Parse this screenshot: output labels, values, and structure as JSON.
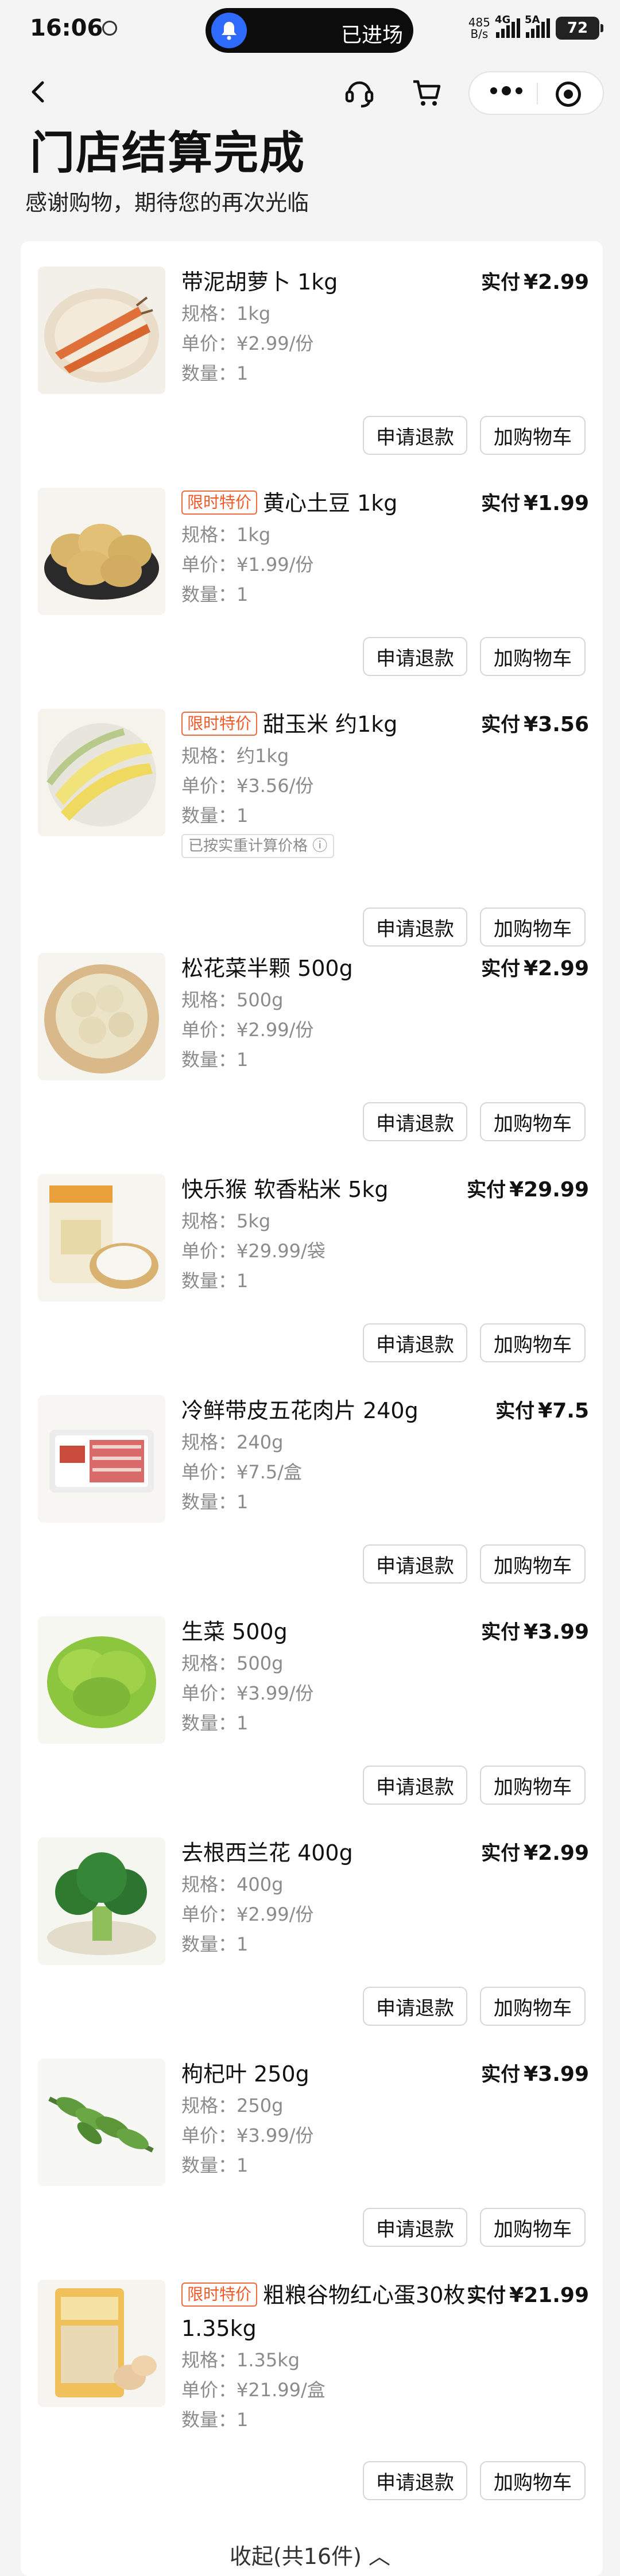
{
  "status": {
    "time": "16:06",
    "island_text": "已进场",
    "net_speed": "485",
    "net_unit": "B/s",
    "net_type": "4G",
    "net_type2": "5A",
    "battery": "72"
  },
  "header": {
    "title": "门店结算完成",
    "subtitle": "感谢购物，期待您的再次光临"
  },
  "labels": {
    "paid": "实付",
    "spec": "规格：",
    "unit_price": "单价：",
    "qty": "数量：",
    "refund": "申请退款",
    "add_cart": "加购物车"
  },
  "items": [
    {
      "name": "带泥胡萝卜 1kg",
      "tag": "",
      "price": "¥2.99",
      "spec": "1kg",
      "unit_price": "¥2.99/份",
      "qty": "1",
      "note": "",
      "thumb": "carrot"
    },
    {
      "name": "黄心土豆 1kg",
      "tag": "限时特价",
      "price": "¥1.99",
      "spec": "1kg",
      "unit_price": "¥1.99/份",
      "qty": "1",
      "note": "",
      "thumb": "potato"
    },
    {
      "name": "甜玉米 约1kg",
      "tag": "限时特价",
      "price": "¥3.56",
      "spec": "约1kg",
      "unit_price": "¥3.56/份",
      "qty": "1",
      "note": "已按实重计算价格",
      "thumb": "corn"
    },
    {
      "name": "松花菜半颗 500g",
      "tag": "",
      "price": "¥2.99",
      "spec": "500g",
      "unit_price": "¥2.99/份",
      "qty": "1",
      "note": "",
      "thumb": "cauliflower"
    },
    {
      "name": "快乐猴 软香粘米 5kg",
      "tag": "",
      "price": "¥29.99",
      "spec": "5kg",
      "unit_price": "¥29.99/袋",
      "qty": "1",
      "note": "",
      "thumb": "rice"
    },
    {
      "name": "冷鲜带皮五花肉片 240g",
      "tag": "",
      "price": "¥7.5",
      "spec": "240g",
      "unit_price": "¥7.5/盒",
      "qty": "1",
      "note": "",
      "thumb": "pork"
    },
    {
      "name": "生菜 500g",
      "tag": "",
      "price": "¥3.99",
      "spec": "500g",
      "unit_price": "¥3.99/份",
      "qty": "1",
      "note": "",
      "thumb": "lettuce"
    },
    {
      "name": "去根西兰花 400g",
      "tag": "",
      "price": "¥2.99",
      "spec": "400g",
      "unit_price": "¥2.99/份",
      "qty": "1",
      "note": "",
      "thumb": "broccoli"
    },
    {
      "name": "枸杞叶 250g",
      "tag": "",
      "price": "¥3.99",
      "spec": "250g",
      "unit_price": "¥3.99/份",
      "qty": "1",
      "note": "",
      "thumb": "greens"
    },
    {
      "name": "粗粮谷物红心蛋30枚 1.35kg",
      "tag": "限时特价",
      "price": "¥21.99",
      "spec": "1.35kg",
      "unit_price": "¥21.99/盒",
      "qty": "1",
      "note": "",
      "thumb": "eggs"
    }
  ],
  "footer": {
    "collapse": "收起(共16件)"
  }
}
